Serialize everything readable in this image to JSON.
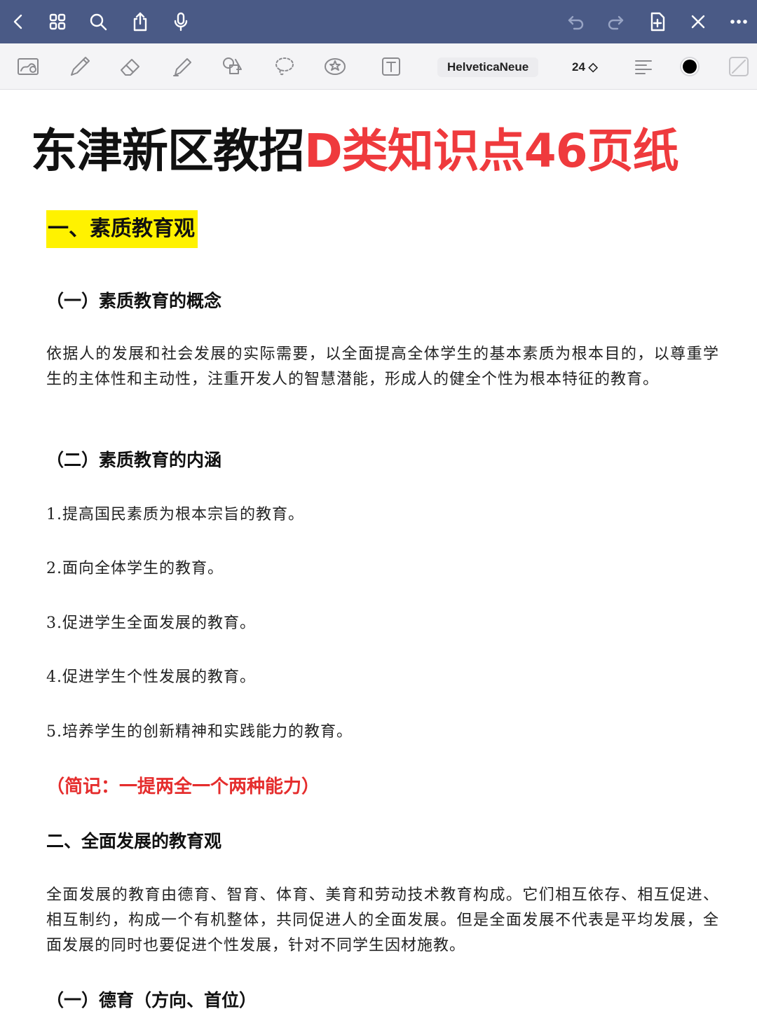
{
  "toolbar": {
    "font_name": "HelveticaNeue",
    "font_size": "24 ◇"
  },
  "icons": {
    "nav_left": [
      "back-icon",
      "grid-icon",
      "search-icon",
      "share-icon",
      "microphone-icon"
    ],
    "nav_right": [
      "undo-icon",
      "redo-icon",
      "add-page-icon",
      "close-icon",
      "more-icon"
    ],
    "tools": [
      "image-icon",
      "pen-icon",
      "eraser-icon",
      "highlighter-icon",
      "shapes-icon",
      "lasso-icon",
      "sticker-icon",
      "text-box-icon",
      "align-icon",
      "color-icon",
      "fill-icon"
    ]
  },
  "colors": {
    "nav_bg": "#4a5a86",
    "title_red": "#ef3a3d",
    "highlight": "#fff200",
    "memo_red": "#e52d2d"
  },
  "document": {
    "title_black": "东津新区教招",
    "title_red": "D类知识点46页纸",
    "section1_title": "一、素质教育观",
    "sub1_title": "（一）素质教育的概念",
    "sub1_text": "依据人的发展和社会发展的实际需要，以全面提高全体学生的基本素质为根本目的，以尊重学生的主体性和主动性，注重开发人的智慧潜能，形成人的健全个性为根本特征的教育。",
    "sub2_title": "（二）素质教育的内涵",
    "items": [
      "1.提高国民素质为根本宗旨的教育。",
      "2.面向全体学生的教育。",
      "3.促进学生全面发展的教育。",
      "4.促进学生个性发展的教育。",
      "5.培养学生的创新精神和实践能力的教育。"
    ],
    "memo": "（简记：一提两全一个两种能力）",
    "section2_title": "二、全面发展的教育观",
    "section2_text": "全面发展的教育由德育、智育、体育、美育和劳动技术教育构成。它们相互依存、相互促进、相互制约，构成一个有机整体，共同促进人的全面发展。但是全面发展不代表是平均发展，全面发展的同时也要促进个性发展，针对不同学生因材施教。",
    "sub3_title": "（一）德育（方向、首位）"
  }
}
